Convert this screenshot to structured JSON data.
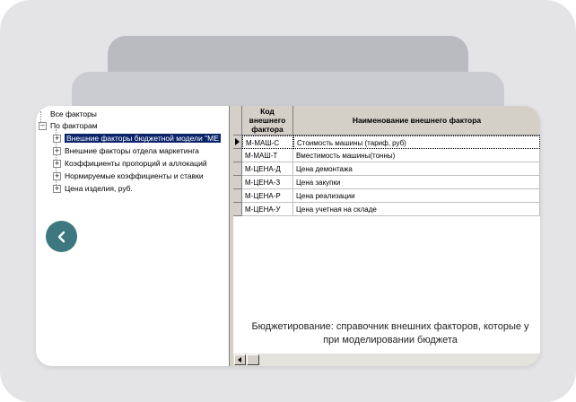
{
  "tree": {
    "root_label": "Все факторы",
    "group_label": "По факторам",
    "group_expander": "−",
    "items": [
      {
        "label": "Внешние факторы бюджетной модели \"МЕ",
        "expander": "+",
        "selected": true
      },
      {
        "label": "Внешние факторы отдела маркетинга",
        "expander": "+"
      },
      {
        "label": "Коэффициенты пропорций и аллокаций",
        "expander": "+"
      },
      {
        "label": "Нормируемые коэффициенты и ставки",
        "expander": "+"
      },
      {
        "label": "Цена изделия, руб.",
        "expander": "+"
      }
    ]
  },
  "grid": {
    "columns": [
      "Код внешнего фактора",
      "Наименование внешнего фактора"
    ],
    "rows": [
      {
        "code": "М-МАШ-С",
        "name": "Стоимость машины (тариф, руб)",
        "current": true
      },
      {
        "code": "М-МАШ-Т",
        "name": "Вместимость машины(тонны)"
      },
      {
        "code": "М-ЦЕНА-Д",
        "name": "Цена демонтажа"
      },
      {
        "code": "М-ЦЕНА-З",
        "name": "Цена закупки"
      },
      {
        "code": "М-ЦЕНА-Р",
        "name": "Цена реализации"
      },
      {
        "code": "М-ЦЕНА-У",
        "name": "Цена учетная на складе"
      }
    ],
    "note_line1": "Бюджетирование: справочник внешних факторов, которые у",
    "note_line2": "при моделировании бюджета"
  },
  "colors": {
    "accent": "#3d7880",
    "selection": "#0a246a",
    "chrome": "#d4d0c8"
  },
  "icons": {
    "back": "chevron-left-icon",
    "scroll_left": "arrow-left-icon"
  }
}
